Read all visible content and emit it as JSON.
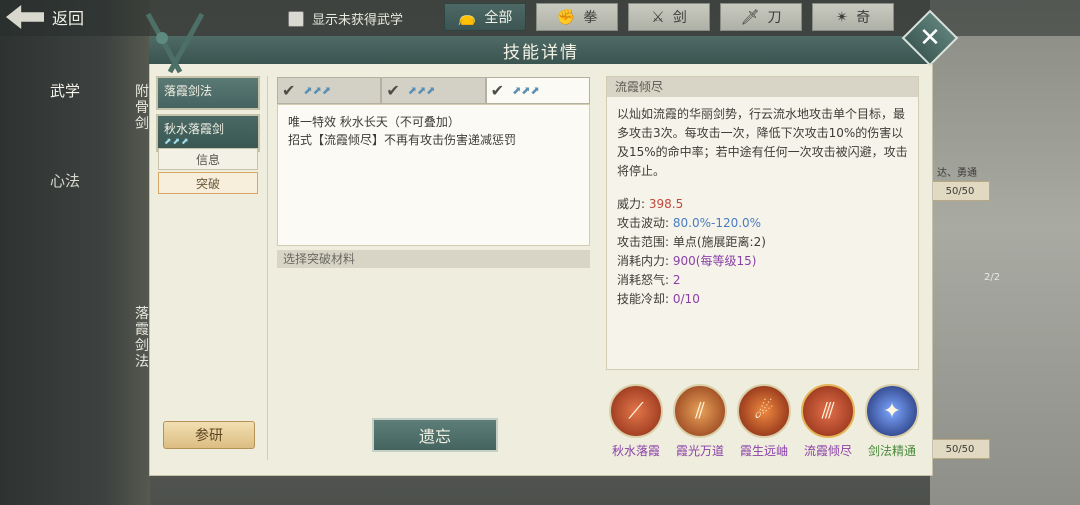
{
  "topbar": {
    "back_label": "返回",
    "filter_label": "显示未获得武学",
    "categories": [
      {
        "label": "全部",
        "icon": "bag-icon"
      },
      {
        "label": "拳",
        "icon": "fist-icon"
      },
      {
        "label": "剑",
        "icon": "sword-icon"
      },
      {
        "label": "刀",
        "icon": "blade-icon"
      },
      {
        "label": "奇",
        "icon": "shuriken-icon"
      }
    ]
  },
  "side_tabs": {
    "wuxue": "武学",
    "xinfa": "心法"
  },
  "background": {
    "counts": [
      "50/50",
      "50/50"
    ],
    "card_vertical_1": "附骨剑",
    "card_vertical_2": "落霞剑法",
    "stack_badge": "2/2",
    "partial_label": "达、勇通"
  },
  "dialog": {
    "title": "技能详情",
    "skills": [
      {
        "name": "落霞剑法",
        "tag": ""
      },
      {
        "name": "秋水落霞剑",
        "tag": "⬈⬈⬈"
      }
    ],
    "sub_tabs": [
      "信息",
      "突破"
    ],
    "research_label": "参研",
    "tiers": [
      {
        "checked": "✔",
        "icons": "⬈⬈⬈"
      },
      {
        "checked": "✔",
        "icons": "⬈⬈⬈"
      },
      {
        "checked": "✔",
        "icons": "⬈⬈⬈"
      }
    ],
    "effects": [
      "唯一特效 秋水长天（不可叠加）",
      "招式【流霞倾尽】不再有攻击伤害递减惩罚"
    ],
    "material_header": "选择突破材料",
    "forget_label": "遗忘",
    "desc": {
      "header": "流霞倾尽",
      "text": "以灿如流霞的华丽剑势，行云流水地攻击单个目标，最多攻击3次。每攻击一次，降低下次攻击10%的伤害以及15%的命中率；若中途有任何一次攻击被闪避，攻击将停止。",
      "stats": [
        {
          "label": "威力:",
          "value": "398.5",
          "color": "#c0483a"
        },
        {
          "label": "攻击波动:",
          "value": "80.0%-120.0%",
          "color": "#4a7cc0"
        },
        {
          "label": "攻击范围:",
          "value": "单点(施展距离:2)",
          "color": "#3d3c36"
        },
        {
          "label": "消耗内力:",
          "value": "900(每等级15)",
          "color": "#8a3fa8"
        },
        {
          "label": "消耗怒气:",
          "value": "2",
          "color": "#8a3fa8"
        },
        {
          "label": "技能冷却:",
          "value": "0/10",
          "color": "#8a3fa8"
        }
      ]
    },
    "moves": [
      {
        "label": "秋水落霞",
        "color": "#8a3fa8",
        "bg": "#b8472b",
        "icon": "⟋"
      },
      {
        "label": "霞光万道",
        "color": "#8a3fa8",
        "bg": "#b8572b",
        "icon": "⫽"
      },
      {
        "label": "霞生远岫",
        "color": "#8a3fa8",
        "bg": "#a8391f",
        "icon": "☄"
      },
      {
        "label": "流霞倾尽",
        "color": "#8a3fa8",
        "bg": "#b4442a",
        "icon": "⫻"
      },
      {
        "label": "剑法精通",
        "color": "#4a8a3a",
        "bg": "#2a3f8a",
        "icon": "✦"
      }
    ]
  }
}
